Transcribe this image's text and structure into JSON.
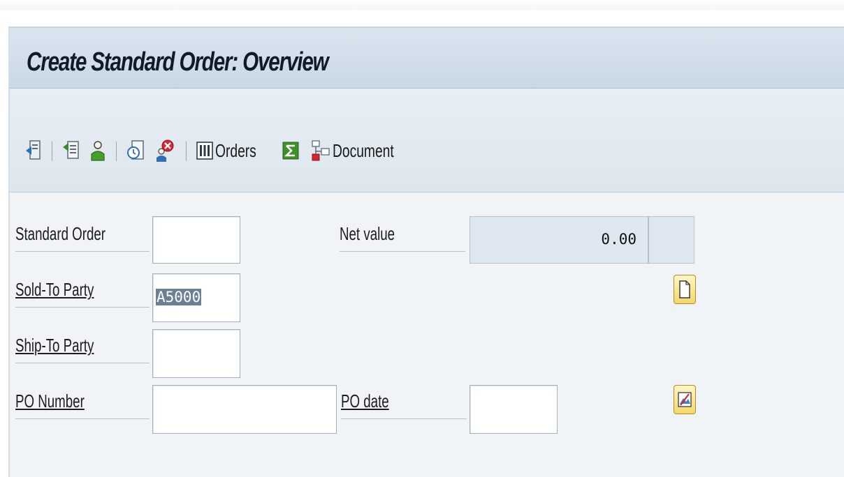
{
  "window": {
    "title": "Create Standard Order: Overview"
  },
  "toolbar": {
    "items": [
      {
        "icon": "display-doc-flow-icon"
      },
      {
        "icon": "header-details-icon"
      },
      {
        "icon": "business-partner-icon"
      },
      {
        "icon": "item-overview-icon"
      },
      {
        "icon": "incompletion-log-icon"
      },
      {
        "icon": "orders-list-icon",
        "label": "Orders"
      },
      {
        "icon": "sum-icon"
      },
      {
        "icon": "document-flow-icon",
        "label": "Document"
      }
    ]
  },
  "form": {
    "standard_order": {
      "label": "Standard Order",
      "value": ""
    },
    "net_value": {
      "label": "Net value",
      "value": "0.00",
      "currency": ""
    },
    "sold_to_party": {
      "label": "Sold-To Party",
      "value": "A5000"
    },
    "ship_to_party": {
      "label": "Ship-To Party",
      "value": ""
    },
    "po_number": {
      "label": "PO Number",
      "value": ""
    },
    "po_date": {
      "label": "PO date",
      "value": ""
    }
  },
  "colors": {
    "title_bar": "#c9d8e6",
    "toolbar": "#dde6ee",
    "background": "#f1f4f7",
    "button_yellow": "#f2d86a"
  }
}
